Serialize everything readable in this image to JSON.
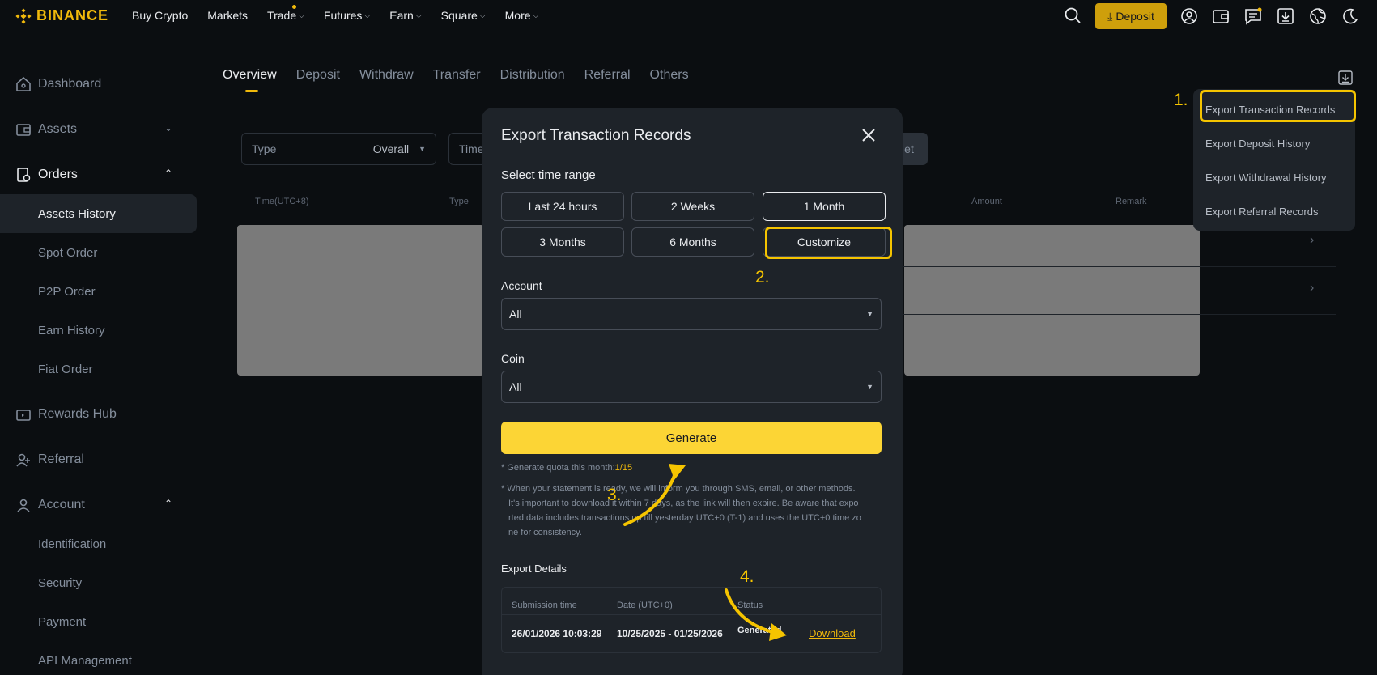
{
  "brand": {
    "name": "BINANCE",
    "color": "#f0b90b"
  },
  "topnav": {
    "items": [
      {
        "label": "Buy Crypto",
        "chevron": false
      },
      {
        "label": "Markets",
        "chevron": false
      },
      {
        "label": "Trade",
        "chevron": true
      },
      {
        "label": "Futures",
        "chevron": true
      },
      {
        "label": "Earn",
        "chevron": true
      },
      {
        "label": "Square",
        "chevron": true
      },
      {
        "label": "More",
        "chevron": true
      }
    ],
    "deposit_label": "Deposit",
    "icons": [
      "search-icon",
      "user-icon",
      "wallet-icon",
      "messages-icon",
      "download-icon",
      "globe-icon",
      "moon-icon"
    ]
  },
  "sidebar": {
    "items": [
      {
        "label": "Dashboard",
        "icon": "home-icon"
      },
      {
        "label": "Assets",
        "icon": "wallet-icon"
      },
      {
        "label": "Orders",
        "icon": "orders-icon"
      },
      {
        "label": "Rewards Hub",
        "icon": "rewards-icon"
      },
      {
        "label": "Referral",
        "icon": "referral-icon"
      },
      {
        "label": "Account",
        "icon": "account-icon"
      }
    ],
    "orders_sub": [
      "Assets History",
      "Spot Order",
      "P2P Order",
      "Earn History",
      "Fiat Order"
    ],
    "account_sub": [
      "Identification",
      "Security",
      "Payment",
      "API Management"
    ],
    "active": "Assets History"
  },
  "tabs": [
    "Overview",
    "Deposit",
    "Withdraw",
    "Transfer",
    "Distribution",
    "Referral",
    "Others"
  ],
  "filters": {
    "type_label": "Type",
    "type_value": "Overall",
    "time_label": "Time",
    "reset_label": "et"
  },
  "table_headers": [
    "Time(UTC+8)",
    "Type",
    "Amount",
    "Remark"
  ],
  "export_menu": {
    "items": [
      "Export Transaction Records",
      "Export Deposit History",
      "Export Withdrawal History",
      "Export Referral Records"
    ]
  },
  "modal": {
    "title": "Export Transaction Records",
    "time_range_label": "Select time range",
    "time_ranges": [
      "Last 24 hours",
      "2 Weeks",
      "1 Month",
      "3 Months",
      "6 Months",
      "Customize"
    ],
    "selected_range": "1 Month",
    "account_label": "Account",
    "account_value": "All",
    "coin_label": "Coin",
    "coin_value": "All",
    "generate_label": "Generate",
    "quota_text": "* Generate quota this month:",
    "quota_value": "1/15",
    "note_line1": "* When your statement is ready, we will inform you through SMS, email, or other methods.",
    "note_line2": "It's important to download it within 7 days, as the link will then expire. Be aware that expo",
    "note_line3": "rted data includes transactions up till yesterday UTC+0 (T-1) and uses the UTC+0 time zo",
    "note_line4": "ne for consistency.",
    "details_label": "Export Details",
    "details_headers": [
      "Submission time",
      "Date (UTC+0)",
      "Status"
    ],
    "details_row": {
      "submission_time": "26/01/2026 10:03:29",
      "date_range": "10/25/2025 - 01/25/2026",
      "status": "Generated",
      "download_label": "Download"
    }
  },
  "annotations": [
    "1.",
    "2.",
    "3.",
    "4."
  ],
  "colors": {
    "accent": "#f0b90b",
    "annotation": "#f5c400",
    "background": "#0b0e11",
    "panel": "#1e2329"
  }
}
